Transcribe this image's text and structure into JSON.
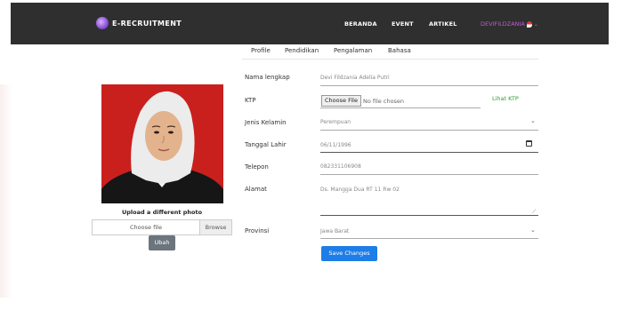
{
  "brand": {
    "name": "E-RECRUITMENT"
  },
  "nav": {
    "links": [
      "BERANDA",
      "EVENT",
      "ARTIKEL"
    ],
    "user": "DEVIFILDZANIA"
  },
  "tabs": [
    "Profile",
    "Pendidikan",
    "Pengalaman",
    "Bahasa"
  ],
  "photo": {
    "upload_label": "Upload a different photo",
    "file_placeholder": "Choose file",
    "browse_label": "Browse",
    "ubah_label": "Ubah"
  },
  "form": {
    "nama": {
      "label": "Nama lengkap",
      "value": "Devi Fildzania Adelia Putri"
    },
    "ktp": {
      "label": "KTP",
      "button": "Choose File",
      "no_file": "No file chosen",
      "link": "Lihat KTP"
    },
    "jenis_kelamin": {
      "label": "Jenis Kelamin",
      "value": "Perempuan"
    },
    "tanggal_lahir": {
      "label": "Tanggal Lahir",
      "value": "06/11/1996"
    },
    "telepon": {
      "label": "Telepon",
      "value": "082331106908"
    },
    "alamat": {
      "label": "Alamat",
      "value": "Ds. Mangga Dua RT 11 Rw 02"
    },
    "provinsi": {
      "label": "Provinsi",
      "value": "Jawa Barat"
    },
    "save_label": "Save Changes"
  },
  "colors": {
    "navbar": "#2f2f2f",
    "user": "#c05ad6",
    "primary": "#1e7de6",
    "success": "#2e9e2e",
    "secondary": "#6c757d",
    "photo_bg": "#c9201e"
  }
}
